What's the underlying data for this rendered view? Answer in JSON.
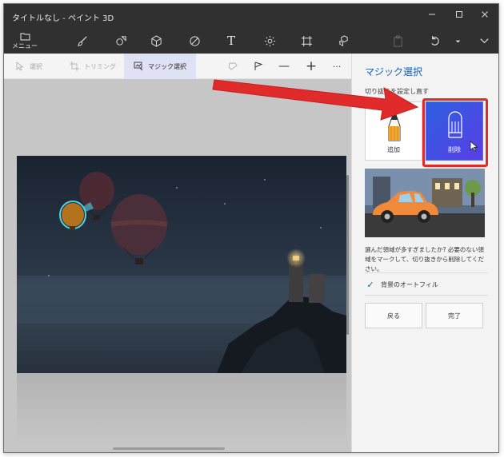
{
  "window": {
    "title": "タイトルなし - ペイント 3D",
    "minimize_icon": "minimize-icon",
    "maximize_icon": "maximize-icon",
    "close_icon": "close-icon"
  },
  "toolbar": {
    "menu_label": "メニュー",
    "tools": [
      {
        "icon": "brush-icon"
      },
      {
        "icon": "2d-shapes-icon"
      },
      {
        "icon": "3d-shapes-icon"
      },
      {
        "icon": "stickers-icon"
      },
      {
        "icon": "text-icon",
        "glyph": "T"
      },
      {
        "icon": "effects-icon"
      },
      {
        "icon": "canvas-icon"
      },
      {
        "icon": "3d-library-icon"
      },
      {
        "icon": "paste-icon"
      },
      {
        "icon": "undo-icon"
      },
      {
        "icon": "more-dropdown-icon"
      },
      {
        "icon": "expand-icon"
      }
    ]
  },
  "subtoolbar": {
    "select_label": "選択",
    "trim_label": "トリミング",
    "magic_select_label": "マジック選択",
    "minus_glyph": "—",
    "plus_glyph": "+",
    "more_glyph": "···"
  },
  "panel": {
    "title": "マジック選択",
    "subtitle": "切り抜きを設定し直す",
    "add_label": "追加",
    "remove_label": "削除",
    "hint": "選んだ領域が多すぎましたか? 必要のない領域をマークして、切り抜きから削除してください。",
    "autofill_label": "背景のオートフィル",
    "autofill_checked": true,
    "check_glyph": "✓",
    "back_label": "戻る",
    "done_label": "完了"
  },
  "colors": {
    "accent": "#1a5fb4",
    "highlight": "#e02a2a",
    "remove_button": "#3a55e4"
  }
}
